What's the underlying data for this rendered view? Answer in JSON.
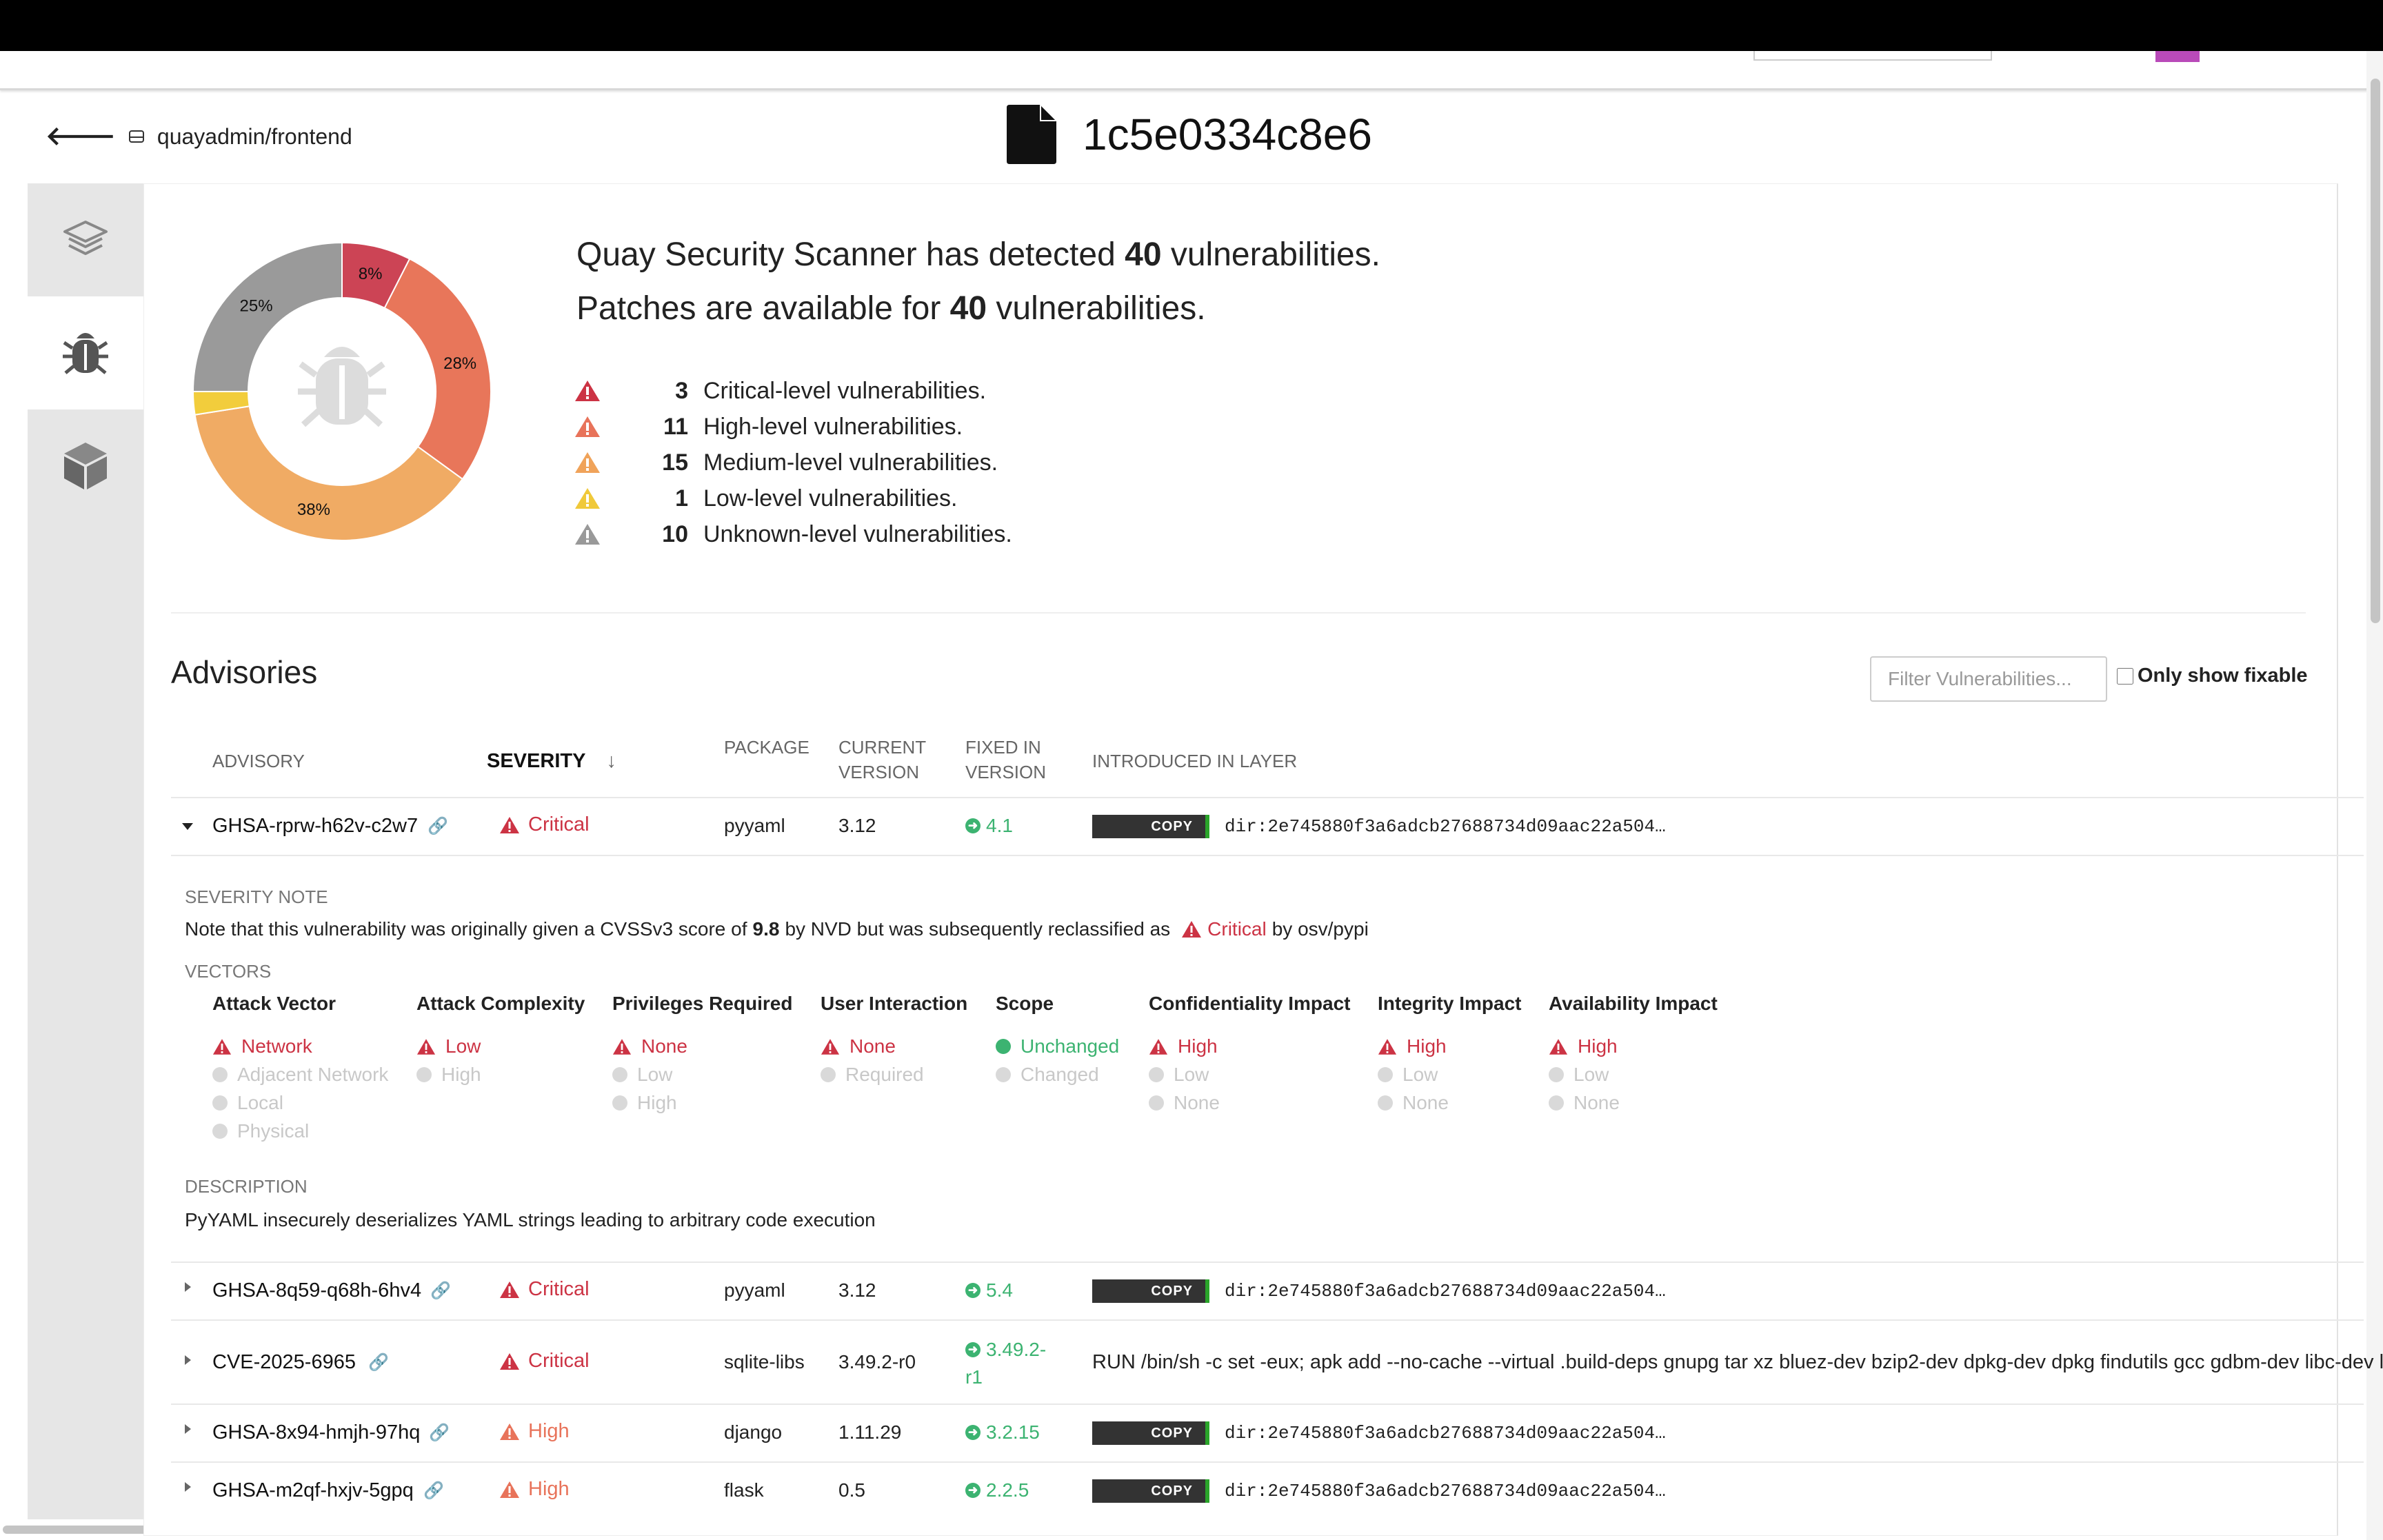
{
  "header": {
    "repo_link": "quayadmin/frontend",
    "manifest_id": "1c5e0334c8e6"
  },
  "sidebar": {
    "tabs": [
      {
        "icon": "layers-icon",
        "active": false
      },
      {
        "icon": "bug-icon",
        "active": true
      },
      {
        "icon": "package-icon",
        "active": false
      }
    ]
  },
  "summary": {
    "line1_pre": "Quay Security Scanner has detected",
    "line1_count": "40",
    "line1_post": "vulnerabilities.",
    "line2_pre": "Patches are available for",
    "line2_count": "40",
    "line2_post": "vulnerabilities.",
    "levels": [
      {
        "count": "3",
        "label": "Critical-level vulnerabilities.",
        "color": "#cc3344"
      },
      {
        "count": "11",
        "label": "High-level vulnerabilities.",
        "color": "#e8735a"
      },
      {
        "count": "15",
        "label": "Medium-level vulnerabilities.",
        "color": "#f0a35a"
      },
      {
        "count": "1",
        "label": "Low-level vulnerabilities.",
        "color": "#f0c93a"
      },
      {
        "count": "10",
        "label": "Unknown-level vulnerabilities.",
        "color": "#999999"
      }
    ],
    "donut": {
      "slices": [
        {
          "name": "Critical",
          "value": 3,
          "color": "#cc4455",
          "label": "8%"
        },
        {
          "name": "High",
          "value": 11,
          "color": "#e8765a",
          "label": "28%"
        },
        {
          "name": "Medium",
          "value": 15,
          "color": "#f0ab64",
          "label": "38%"
        },
        {
          "name": "Low",
          "value": 1,
          "color": "#f2cd3c",
          "label": ""
        },
        {
          "name": "Unknown",
          "value": 10,
          "color": "#9a9a9a",
          "label": "25%"
        }
      ]
    }
  },
  "advisories": {
    "title": "Advisories",
    "filter_placeholder": "Filter Vulnerabilities...",
    "only_fixable_label": "Only show fixable",
    "columns": {
      "advisory": "ADVISORY",
      "severity": "SEVERITY",
      "sort_arrow": "↓",
      "package": "PACKAGE",
      "current_1": "CURRENT",
      "current_2": "VERSION",
      "fixed_1": "FIXED IN",
      "fixed_2": "VERSION",
      "layer": "INTRODUCED IN LAYER"
    },
    "copy_label": "COPY",
    "rows": [
      {
        "id": "GHSA-rprw-h62v-c2w7",
        "severity": "Critical",
        "package": "pyyaml",
        "current": "3.12",
        "fixed": "4.1",
        "layer": "dir:2e745880f3a6adcb27688734d09aac22a504…"
      },
      {
        "id": "GHSA-8q59-q68h-6hv4",
        "severity": "Critical",
        "package": "pyyaml",
        "current": "3.12",
        "fixed": "5.4",
        "layer": "dir:2e745880f3a6adcb27688734d09aac22a504…"
      },
      {
        "id": "CVE-2025-6965",
        "severity": "Critical",
        "package": "sqlite-libs",
        "current": "3.49.2-r0",
        "fixed_1": "3.49.2-",
        "fixed_2": "r1",
        "layer": "RUN /bin/sh -c set -eux; apk add --no-cache --virtual .build-deps gnupg tar xz bluez-dev bzip2-dev dpkg-dev dpkg findutils gcc gdbm-dev libc-dev libffi"
      },
      {
        "id": "GHSA-8x94-hmjh-97hq",
        "severity": "High",
        "package": "django",
        "current": "1.11.29",
        "fixed": "3.2.15",
        "layer": "dir:2e745880f3a6adcb27688734d09aac22a504…"
      },
      {
        "id": "GHSA-m2qf-hxjv-5gpq",
        "severity": "High",
        "package": "flask",
        "current": "0.5",
        "fixed": "2.2.5",
        "layer": "dir:2e745880f3a6adcb27688734d09aac22a504…"
      }
    ],
    "expanded": {
      "severity_note_label": "SEVERITY NOTE",
      "note_pre": "Note that this vulnerability was originally given a CVSSv3 score of",
      "note_score": "9.8",
      "note_mid": "by NVD but was subsequently reclassified as",
      "note_sev": "Critical",
      "note_post": "by osv/pypi",
      "vectors_label": "VECTORS",
      "vectors": [
        {
          "title": "Attack Vector",
          "options": [
            {
              "text": "Network",
              "state": "bad"
            },
            {
              "text": "Adjacent Network",
              "state": "off"
            },
            {
              "text": "Local",
              "state": "off"
            },
            {
              "text": "Physical",
              "state": "off"
            }
          ]
        },
        {
          "title": "Attack Complexity",
          "options": [
            {
              "text": "Low",
              "state": "bad"
            },
            {
              "text": "High",
              "state": "off"
            }
          ]
        },
        {
          "title": "Privileges Required",
          "options": [
            {
              "text": "None",
              "state": "bad"
            },
            {
              "text": "Low",
              "state": "off"
            },
            {
              "text": "High",
              "state": "off"
            }
          ]
        },
        {
          "title": "User Interaction",
          "options": [
            {
              "text": "None",
              "state": "bad"
            },
            {
              "text": "Required",
              "state": "off"
            }
          ]
        },
        {
          "title": "Scope",
          "options": [
            {
              "text": "Unchanged",
              "state": "good"
            },
            {
              "text": "Changed",
              "state": "off"
            }
          ]
        },
        {
          "title": "Confidentiality Impact",
          "options": [
            {
              "text": "High",
              "state": "bad"
            },
            {
              "text": "Low",
              "state": "off"
            },
            {
              "text": "None",
              "state": "off"
            }
          ]
        },
        {
          "title": "Integrity Impact",
          "options": [
            {
              "text": "High",
              "state": "bad"
            },
            {
              "text": "Low",
              "state": "off"
            },
            {
              "text": "None",
              "state": "off"
            }
          ]
        },
        {
          "title": "Availability Impact",
          "options": [
            {
              "text": "High",
              "state": "bad"
            },
            {
              "text": "Low",
              "state": "off"
            },
            {
              "text": "None",
              "state": "off"
            }
          ]
        }
      ],
      "description_label": "DESCRIPTION",
      "description": "PyYAML insecurely deserializes YAML strings leading to arbitrary code execution"
    }
  },
  "colors": {
    "critical": "#cc3344",
    "high": "#e8735a",
    "fixed": "#3cb371",
    "link": "#2a66d8"
  }
}
